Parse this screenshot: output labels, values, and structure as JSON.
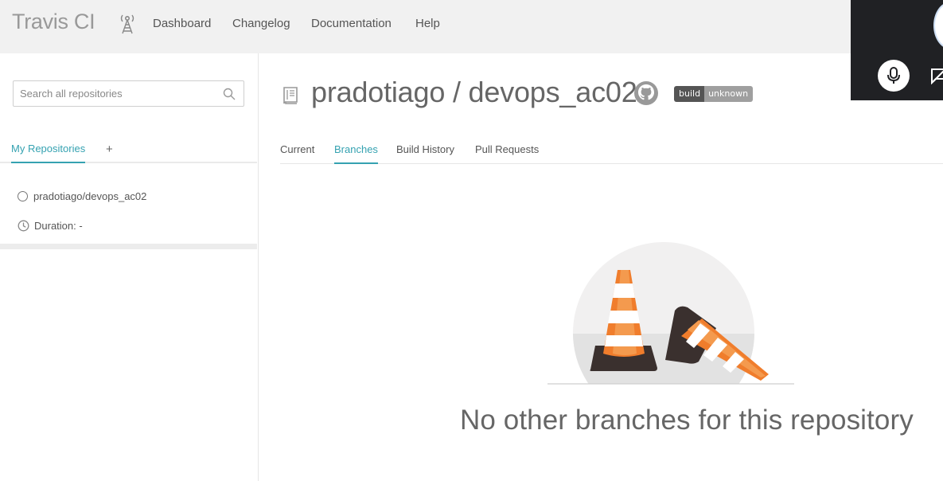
{
  "header": {
    "brand": "Travis CI",
    "nav": [
      "Dashboard",
      "Changelog",
      "Documentation",
      "Help"
    ]
  },
  "sidebar": {
    "search": {
      "placeholder": "Search all repositories",
      "value": ""
    },
    "tabs": {
      "my_repositories": "My Repositories",
      "add": "+"
    },
    "repos": [
      {
        "name": "pradotiago/devops_ac02",
        "duration": "Duration: -"
      }
    ]
  },
  "main": {
    "repo_title": "pradotiago / devops_ac02",
    "badge": {
      "label": "build",
      "status": "unknown"
    },
    "tabs": [
      "Current",
      "Branches",
      "Build History",
      "Pull Requests"
    ],
    "active_tab": "Branches",
    "empty_message": "No other branches for this repository"
  },
  "icons": [
    "antenna-icon",
    "microphone-icon",
    "captions-icon",
    "search-icon",
    "repo-book-icon",
    "github-icon",
    "clock-icon",
    "status-ring-icon"
  ],
  "colors": {
    "accent": "#35a2b1",
    "topbar": "#f1f1f1",
    "cone_orange": "#f07d2c",
    "overlay": "#202124"
  }
}
